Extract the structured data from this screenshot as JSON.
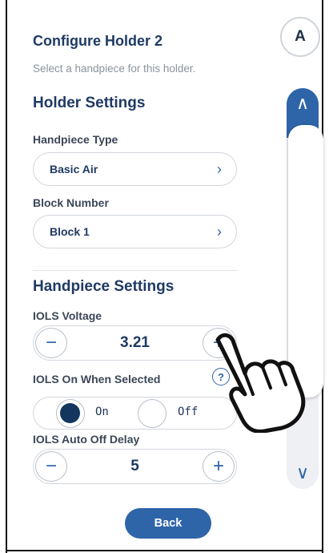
{
  "header": {
    "title": "Configure Holder 2",
    "subtitle": "Select a handpiece for this holder.",
    "avatar_letter": "A"
  },
  "holder_settings": {
    "section_title": "Holder Settings",
    "handpiece_type": {
      "label": "Handpiece Type",
      "value": "Basic Air"
    },
    "block_number": {
      "label": "Block Number",
      "value": "Block 1"
    }
  },
  "handpiece_settings": {
    "section_title": "Handpiece Settings",
    "iols_voltage": {
      "label": "IOLS Voltage",
      "value": "3.21"
    },
    "iols_on_when_selected": {
      "label": "IOLS On When Selected",
      "on_label": "On",
      "off_label": "Off",
      "selected": "On"
    },
    "iols_auto_off_delay": {
      "label": "IOLS Auto Off Delay",
      "value": "5"
    }
  },
  "icons": {
    "chevron_right": "›",
    "minus": "−",
    "plus": "+",
    "help": "?",
    "scroll_up": "∧",
    "scroll_down": "∨"
  },
  "footer": {
    "back_label": "Back"
  },
  "colors": {
    "accent": "#2e64a8",
    "title": "#1f3a64",
    "radio_on": "#12365e"
  }
}
